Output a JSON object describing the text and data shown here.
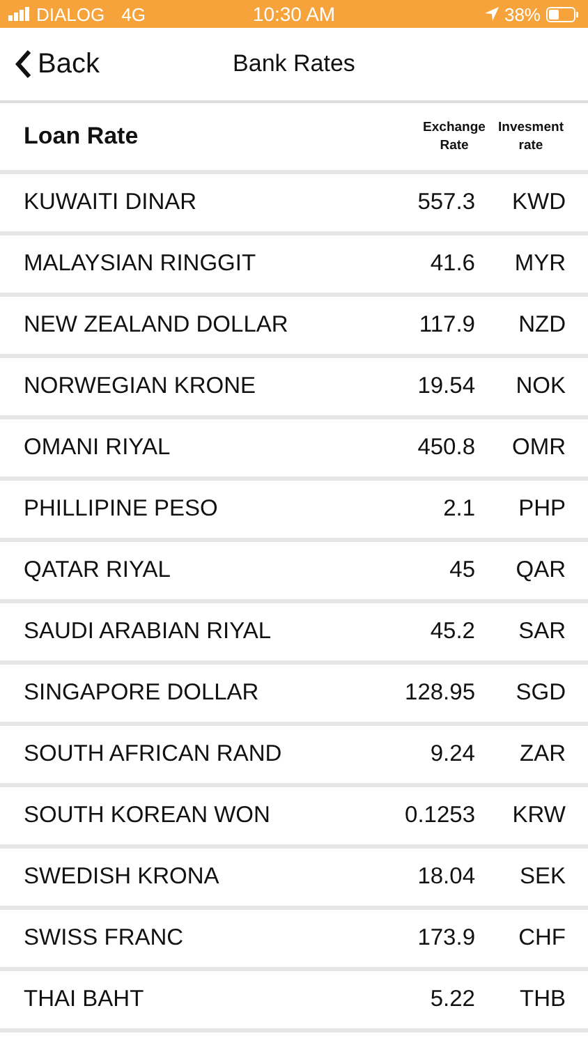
{
  "status_bar": {
    "carrier": "DIALOG",
    "network": "4G",
    "time": "10:30 AM",
    "battery": "38%"
  },
  "nav": {
    "back": "Back",
    "title": "Bank Rates"
  },
  "table": {
    "title": "Loan Rate",
    "columns": [
      "Exchange Rate",
      "Invesment rate"
    ],
    "rows": [
      {
        "name": "KUWAITI DINAR",
        "rate": "557.3",
        "code": "KWD"
      },
      {
        "name": "MALAYSIAN RINGGIT",
        "rate": "41.6",
        "code": "MYR"
      },
      {
        "name": "NEW ZEALAND DOLLAR",
        "rate": "117.9",
        "code": "NZD"
      },
      {
        "name": "NORWEGIAN KRONE",
        "rate": "19.54",
        "code": "NOK"
      },
      {
        "name": "OMANI RIYAL",
        "rate": "450.8",
        "code": "OMR"
      },
      {
        "name": "PHILLIPINE PESO",
        "rate": "2.1",
        "code": "PHP"
      },
      {
        "name": "QATAR RIYAL",
        "rate": "45",
        "code": "QAR"
      },
      {
        "name": "SAUDI ARABIAN RIYAL",
        "rate": "45.2",
        "code": "SAR"
      },
      {
        "name": "SINGAPORE DOLLAR",
        "rate": "128.95",
        "code": "SGD"
      },
      {
        "name": "SOUTH AFRICAN RAND",
        "rate": "9.24",
        "code": "ZAR"
      },
      {
        "name": "SOUTH KOREAN WON",
        "rate": "0.1253",
        "code": "KRW"
      },
      {
        "name": "SWEDISH KRONA",
        "rate": "18.04",
        "code": "SEK"
      },
      {
        "name": "SWISS FRANC",
        "rate": "173.9",
        "code": "CHF"
      },
      {
        "name": "THAI BAHT",
        "rate": "5.22",
        "code": "THB"
      }
    ]
  }
}
